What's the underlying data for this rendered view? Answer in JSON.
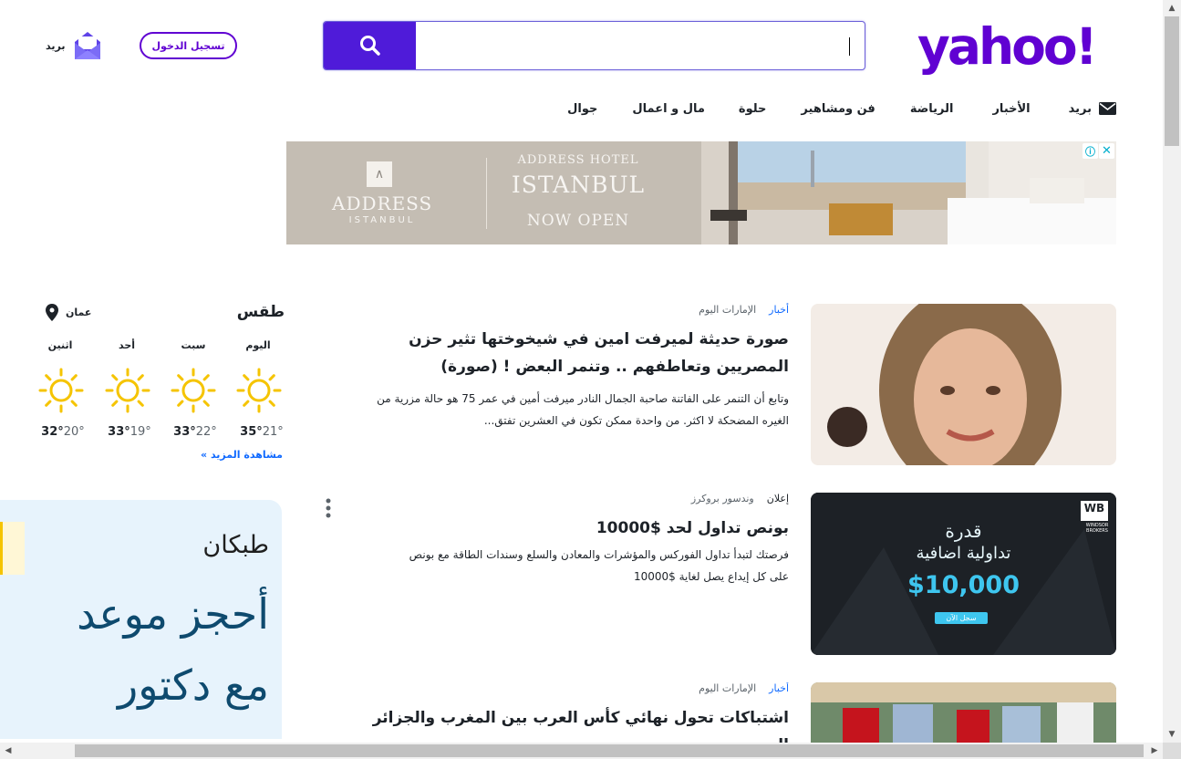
{
  "header": {
    "logo_text": "yahoo!",
    "search_placeholder": "",
    "signin_label": "تسجيل الدخول",
    "mail_label": "بريد"
  },
  "nav": {
    "items": [
      {
        "label": "بريد",
        "icon": "envelope-icon"
      },
      {
        "label": "الأخبار"
      },
      {
        "label": "الرياضة"
      },
      {
        "label": "فن ومشاهير"
      },
      {
        "label": "حلوة"
      },
      {
        "label": "مال و اعمال"
      },
      {
        "label": "جوال"
      }
    ]
  },
  "ad_banner": {
    "brand": "ADDRESS",
    "brand_sub": "ISTANBUL",
    "hotel": "ADDRESS HOTEL",
    "city": "ISTANBUL",
    "cta": "NOW OPEN",
    "info_icon": "ⓘ",
    "close_icon": "✕"
  },
  "weather": {
    "title": "طقس",
    "location": "عمان",
    "more_link": "مشاهدة المزيد »",
    "days": [
      {
        "day": "اليوم",
        "high": "35°",
        "low": "21°",
        "icon": "sun-icon"
      },
      {
        "day": "سبت",
        "high": "33°",
        "low": "22°",
        "icon": "sun-icon"
      },
      {
        "day": "أحد",
        "high": "33°",
        "low": "19°",
        "icon": "sun-icon"
      },
      {
        "day": "اثنين",
        "high": "32°",
        "low": "20°",
        "icon": "sun-icon"
      }
    ]
  },
  "side_ad": {
    "brand": "طبكان",
    "line1": "أحجز موعد",
    "line2": "مع دكتور"
  },
  "stream": [
    {
      "category": "أخبار",
      "source": "الإمارات اليوم",
      "title": "صورة حديثة لميرفت امين في شيخوختها تثير حزن المصريين وتعاطفهم .. وتنمر البعض ! (صورة)",
      "summary": "وتابع أن التنمر على الفاتنة صاحبة الجمال النادر ميرفت أمين في عمر 75 هو حالة مزرية من الغيره المضحكة لا اكثر. من واحدة ممكن تكون في العشرين تفتق..."
    },
    {
      "category": "إعلان",
      "source": "وندسور بروكرز",
      "title": "بونص تداول لحد $10000",
      "summary": "فرصتك لتبدأ تداول الفوركس والمؤشرات والمعادن والسلع وسندات الطاقة مع بونص على كل إيداع يصل لغاية $10000",
      "ad_image": {
        "line1": "قدرة",
        "line2": "تداولية اضافية",
        "amount": "$10,000",
        "cta": "سجل الآن",
        "logo": "WB",
        "logo_sub": "WINDSOR BROKERS"
      }
    },
    {
      "category": "أخبار",
      "source": "الإمارات اليوم",
      "title": "اشتباكات تحول نهائي كأس العرب بين المغرب والجزائر إلى"
    }
  ],
  "colors": {
    "brand_purple": "#6001d2",
    "search_button": "#4f1bd9",
    "link_blue": "#0f69ff",
    "sun": "#f5c400"
  }
}
